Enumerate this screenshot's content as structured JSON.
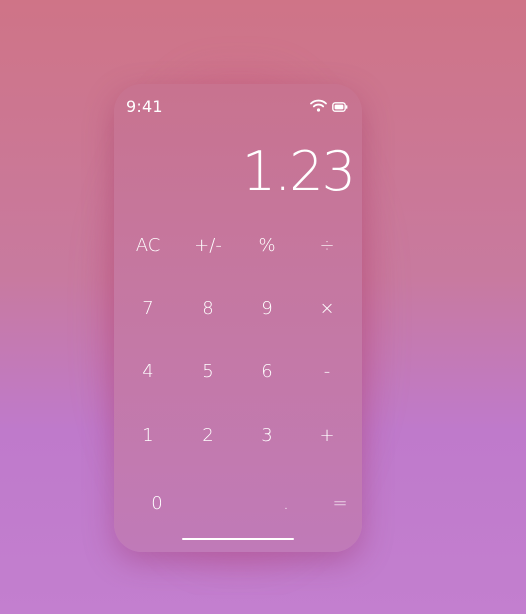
{
  "status_bar": {
    "time": "9:41",
    "icons": [
      "wifi-icon",
      "battery-icon"
    ]
  },
  "display": {
    "value": "1.23"
  },
  "keys": {
    "row1": [
      "AC",
      "+/-",
      "%",
      "÷"
    ],
    "row2": [
      "7",
      "8",
      "9",
      "×"
    ],
    "row3": [
      "4",
      "5",
      "6",
      "-"
    ],
    "row4": [
      "1",
      "2",
      "3",
      "+"
    ],
    "row5": [
      "0",
      ".",
      "="
    ]
  },
  "colors": {
    "background_top": "#cf7487",
    "background_bottom": "#c37fcf",
    "phone_top": "#c8738f",
    "phone_bottom": "#c07ab8",
    "text": "#ffffff"
  }
}
